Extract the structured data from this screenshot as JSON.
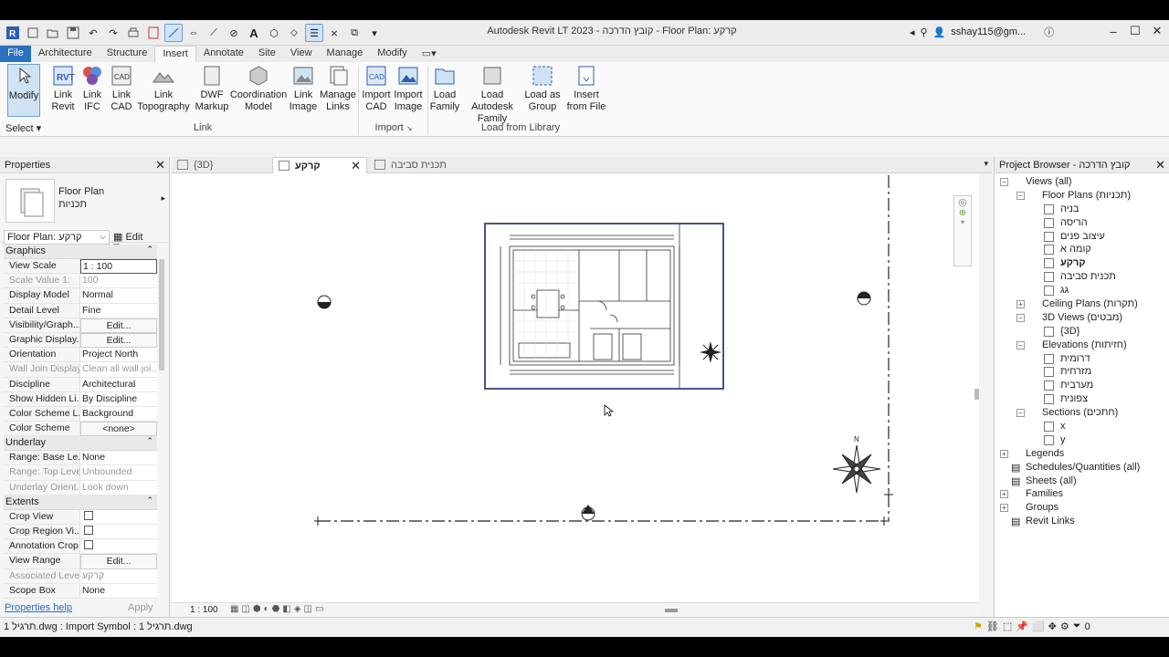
{
  "window": {
    "title": "Autodesk Revit LT 2023 - קובץ הדרכה - Floor Plan: קרקע",
    "user": "sshay115@gm..."
  },
  "menu_tabs": [
    "File",
    "Architecture",
    "Structure",
    "Insert",
    "Annotate",
    "Site",
    "View",
    "Manage",
    "Modify"
  ],
  "ribbon": {
    "modify": "Modify",
    "select": "Select",
    "buttons": [
      {
        "l1": "Link",
        "l2": "Revit"
      },
      {
        "l1": "Link",
        "l2": "IFC"
      },
      {
        "l1": "Link",
        "l2": "CAD"
      },
      {
        "l1": "Link",
        "l2": "Topography"
      },
      {
        "l1": "DWF",
        "l2": "Markup"
      },
      {
        "l1": "Coordination",
        "l2": "Model"
      },
      {
        "l1": "Link",
        "l2": "Image"
      },
      {
        "l1": "Manage",
        "l2": "Links"
      },
      {
        "l1": "Import",
        "l2": "CAD"
      },
      {
        "l1": "Import",
        "l2": "Image"
      },
      {
        "l1": "Load",
        "l2": "Family"
      },
      {
        "l1": "Load Autodesk",
        "l2": "Family"
      },
      {
        "l1": "Load as",
        "l2": "Group"
      },
      {
        "l1": "Insert",
        "l2": "from File"
      }
    ],
    "panels": [
      "Link",
      "Import",
      "Load from Library"
    ]
  },
  "properties": {
    "title": "Properties",
    "type_name": "Floor Plan",
    "type_sub": "תכניות",
    "selector": "Floor Plan: קרקע",
    "edit_type": "Edit Type",
    "sections": {
      "graphics": "Graphics",
      "underlay": "Underlay",
      "extents": "Extents"
    },
    "graphics": [
      {
        "k": "View Scale",
        "v": "1 : 100"
      },
      {
        "k": "Scale Value    1:",
        "v": "100"
      },
      {
        "k": "Display Model",
        "v": "Normal"
      },
      {
        "k": "Detail Level",
        "v": "Fine"
      },
      {
        "k": "Visibility/Graph...",
        "v": "Edit..."
      },
      {
        "k": "Graphic Display...",
        "v": "Edit..."
      },
      {
        "k": "Orientation",
        "v": "Project North"
      },
      {
        "k": "Wall Join Display",
        "v": "Clean all wall joi..."
      },
      {
        "k": "Discipline",
        "v": "Architectural"
      },
      {
        "k": "Show Hidden Li...",
        "v": "By Discipline"
      },
      {
        "k": "Color Scheme L...",
        "v": "Background"
      },
      {
        "k": "Color Scheme",
        "v": "<none>"
      }
    ],
    "underlay": [
      {
        "k": "Range: Base Le...",
        "v": "None"
      },
      {
        "k": "Range: Top Level",
        "v": "Unbounded"
      },
      {
        "k": "Underlay Orient...",
        "v": "Look down"
      }
    ],
    "extents": [
      {
        "k": "Crop View",
        "v": ""
      },
      {
        "k": "Crop Region Vi...",
        "v": ""
      },
      {
        "k": "Annotation Crop",
        "v": ""
      },
      {
        "k": "View Range",
        "v": "Edit..."
      },
      {
        "k": "Associated Level",
        "v": "קרקע"
      },
      {
        "k": "Scope Box",
        "v": "None"
      }
    ],
    "help": "Properties help",
    "apply": "Apply"
  },
  "view_tabs": [
    {
      "label": "{3D}"
    },
    {
      "label": "קרקע"
    },
    {
      "label": "תכנית סביבה"
    }
  ],
  "view_scale": "1 : 100",
  "browser": {
    "title": "Project Browser - קובץ הדרכה",
    "nodes": [
      {
        "label": "Views (all)",
        "lvl": 0,
        "tg": "−"
      },
      {
        "label": "Floor Plans (תכניות)",
        "lvl": 1,
        "tg": "−"
      },
      {
        "label": "בניה",
        "lvl": 2
      },
      {
        "label": "הריסה",
        "lvl": 2
      },
      {
        "label": "עיצוב פנים",
        "lvl": 2
      },
      {
        "label": "קומה א",
        "lvl": 2
      },
      {
        "label": "קרקע",
        "lvl": 2,
        "bold": true
      },
      {
        "label": "תכנית סביבה",
        "lvl": 2
      },
      {
        "label": "גג",
        "lvl": 2
      },
      {
        "label": "Ceiling Plans (תקרות)",
        "lvl": 1,
        "tg": "+"
      },
      {
        "label": "3D Views (מבטים)",
        "lvl": 1,
        "tg": "−"
      },
      {
        "label": "{3D}",
        "lvl": 2
      },
      {
        "label": "Elevations (חזיתות)",
        "lvl": 1,
        "tg": "−"
      },
      {
        "label": "דרומית",
        "lvl": 2
      },
      {
        "label": "מזרחית",
        "lvl": 2
      },
      {
        "label": "מערבית",
        "lvl": 2
      },
      {
        "label": "צפונית",
        "lvl": 2
      },
      {
        "label": "Sections (חתכים)",
        "lvl": 1,
        "tg": "−"
      },
      {
        "label": "x",
        "lvl": 2
      },
      {
        "label": "y",
        "lvl": 2
      },
      {
        "label": "Legends",
        "lvl": 0,
        "tg": "+"
      },
      {
        "label": "Schedules/Quantities (all)",
        "lvl": 0
      },
      {
        "label": "Sheets (all)",
        "lvl": 0
      },
      {
        "label": "Families",
        "lvl": 0,
        "tg": "+"
      },
      {
        "label": "Groups",
        "lvl": 0,
        "tg": "+"
      },
      {
        "label": "Revit Links",
        "lvl": 0
      }
    ]
  },
  "status": {
    "message": "תרגיל 1.dwg : Import Symbol : תרגיל 1.dwg",
    "filter_count": "0"
  },
  "colors": {
    "accent": "#2a72c0",
    "crop": "#1a2a6c"
  }
}
